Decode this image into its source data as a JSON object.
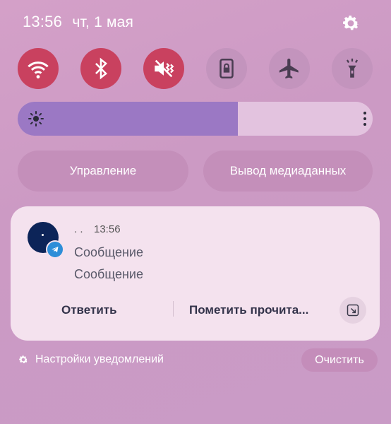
{
  "status": {
    "time": "13:56",
    "date": "чт, 1 мая"
  },
  "quick_tiles": [
    {
      "icon": "wifi-icon",
      "state": "on"
    },
    {
      "icon": "bluetooth-icon",
      "state": "on"
    },
    {
      "icon": "vibrate-mute-icon",
      "state": "on"
    },
    {
      "icon": "screen-lock-icon",
      "state": "off"
    },
    {
      "icon": "airplane-icon",
      "state": "off"
    },
    {
      "icon": "flashlight-icon",
      "state": "off"
    }
  ],
  "brightness": {
    "level": 0.62
  },
  "pills": {
    "control": "Управление",
    "media_output": "Вывод медиаданных"
  },
  "notification": {
    "sender": ". .",
    "time": "13:56",
    "line1": "Сообщение",
    "line2": "Сообщение",
    "reply": "Ответить",
    "mark_read": "Пометить прочита..."
  },
  "footer": {
    "settings": "Настройки уведомлений",
    "clear": "Очистить"
  },
  "colors": {
    "tile_on": "#c9415f",
    "tile_off": "#c394bd",
    "slider_fill": "#9b78c4",
    "telegram": "#2d8ed8"
  }
}
